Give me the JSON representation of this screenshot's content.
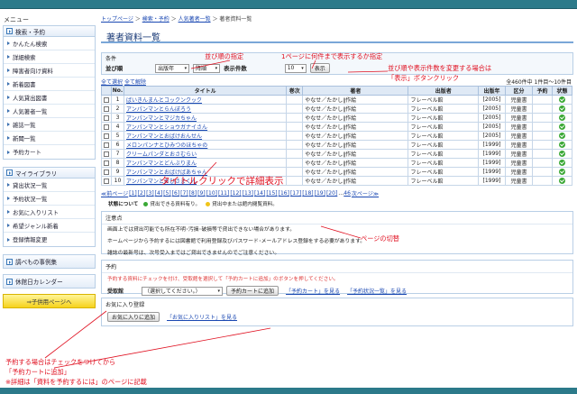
{
  "sidebar": {
    "menu_title": "メニュー",
    "sec1_title": "検索・予約",
    "sec1_items": [
      "かんたん検索",
      "詳細検索",
      "障害者向け資料",
      "新着図書",
      "人気貸出図書",
      "人気著者一覧",
      "雑誌一覧",
      "新聞一覧",
      "予約カート"
    ],
    "sec2_title": "マイライブラリ",
    "sec2_items": [
      "貸出状況一覧",
      "予約状況一覧",
      "お気に入りリスト",
      "希望ジャンル新着",
      "登録情報変更"
    ],
    "sec3_title": "調べもの事例集",
    "sec4_title": "休館日カレンダー",
    "kids_button": "⇒子供用ページへ"
  },
  "breadcrumb": {
    "top": "トップページ",
    "search": "検索・予約",
    "popular": "人気著者一覧",
    "current": "著者資料一覧",
    "sep": " ＞ "
  },
  "page_title": "著者資料一覧",
  "conditions": {
    "label": "条件",
    "sort_label": "並び順",
    "sort_value": "出版年",
    "order_value": "降順",
    "count_label": "表示件数",
    "count_value": "10",
    "show_button": "表示"
  },
  "toolbar": {
    "select_all": "全て選択",
    "clear_all": "全て解除",
    "total": "全460件中 1件目〜10件目"
  },
  "table": {
    "headers": [
      "No.",
      "タイトル",
      "巻次",
      "著者",
      "出版者",
      "出版年",
      "区分",
      "予約",
      "状態"
    ],
    "rows": [
      [
        "1",
        "ばいきんまんとコックンクック",
        "",
        "やなせ／たかし∥作絵",
        "フレーベル館",
        "[2005]",
        "児童書"
      ],
      [
        "2",
        "アンパンマンとらんぼろう",
        "",
        "やなせ／たかし∥作絵",
        "フレーベル館",
        "[2005]",
        "児童書"
      ],
      [
        "3",
        "アンパンマンとマジカちゃん",
        "",
        "やなせ／たかし∥作絵",
        "フレーベル館",
        "[2005]",
        "児童書"
      ],
      [
        "4",
        "アンパンマンとショウガナイさん",
        "",
        "やなせ／たかし∥作絵",
        "フレーベル館",
        "[2005]",
        "児童書"
      ],
      [
        "5",
        "アンパンマンとおばけおんせん",
        "",
        "やなせ／たかし∥作絵",
        "フレーベル館",
        "[2005]",
        "児童書"
      ],
      [
        "6",
        "メロンパンナとひみつのほちゃの",
        "",
        "やなせ／たかし∥作絵",
        "フレーベル館",
        "[1999]",
        "児童書"
      ],
      [
        "7",
        "クリームパンダとおさむらい",
        "",
        "やなせ／たかし∥作絵",
        "フレーベル館",
        "[1999]",
        "児童書"
      ],
      [
        "8",
        "アンパンマンとどんぶりまん",
        "",
        "やなせ／たかし∥作絵",
        "フレーベル館",
        "[1999]",
        "児童書"
      ],
      [
        "9",
        "アンパンマンとおばけばあちゃん",
        "",
        "やなせ／たかし∥作絵",
        "フレーベル館",
        "[1999]",
        "児童書"
      ],
      [
        "10",
        "アンパンマンとおひさまくん",
        "",
        "やなせ／たかし∥作絵",
        "フレーベル館",
        "[1999]",
        "児童書"
      ]
    ]
  },
  "pager": {
    "prev": "≪前ページ",
    "pages": [
      "1",
      "2",
      "3",
      "4",
      "5",
      "6",
      "7",
      "8",
      "9",
      "10",
      "11",
      "12",
      "13",
      "14",
      "15",
      "16",
      "17",
      "18",
      "19",
      "20"
    ],
    "dots": "…",
    "last": "46",
    "next": "次ページ≫"
  },
  "legend": {
    "label": "状態について",
    "available": "貸出できる資料有り。",
    "unavailable": "貸出中または館内閲覧資料。"
  },
  "notes": {
    "title": "注意点",
    "lines": [
      "画面上では貸出可能でも所在不明･汚損･破損等で貸出できない場合があります。",
      "ホームページから予約するには図書館で利用登録及びパスワード･メールアドレス登録をする必要があります。",
      "雑誌の最新号は、次号受入まではご貸出できませんのでご注意ください。"
    ]
  },
  "reserve": {
    "title": "予約",
    "instruction": "予約する資料にチェックを付け、受取館を選択して「予約カートに追加」のボタンを押してください。",
    "pickup_label": "受取館",
    "pickup_value": "（選択してください。）",
    "add_button": "予約カートに追加",
    "cart_link": "「予約カート」を見る",
    "status_link": "「予約状況一覧」を見る"
  },
  "favorites": {
    "title": "お気に入り登録",
    "add_button": "お気に入りに追加",
    "view_link": "「お気に入りリスト」を見る"
  },
  "annotations": {
    "sort": "並び順の指定",
    "perpage": "1ページに何件まで表示するか指定",
    "change1": "並び順や表示件数を変更する場合は",
    "change2": "「表示」ボタンクリック",
    "title_click": "タイトルクリックで詳細表示",
    "page_switch": "ページの切替",
    "reserve1": "予約する場合はチェックをつけてから",
    "reserve2": "「予約カートに追加」",
    "reserve3": "※詳細は「資料を予約するには」のページに記載"
  },
  "colors": {
    "accent": "#2c7a8a",
    "link": "#1a48b2",
    "annotation": "#e01020",
    "ok": "#3aa835"
  }
}
